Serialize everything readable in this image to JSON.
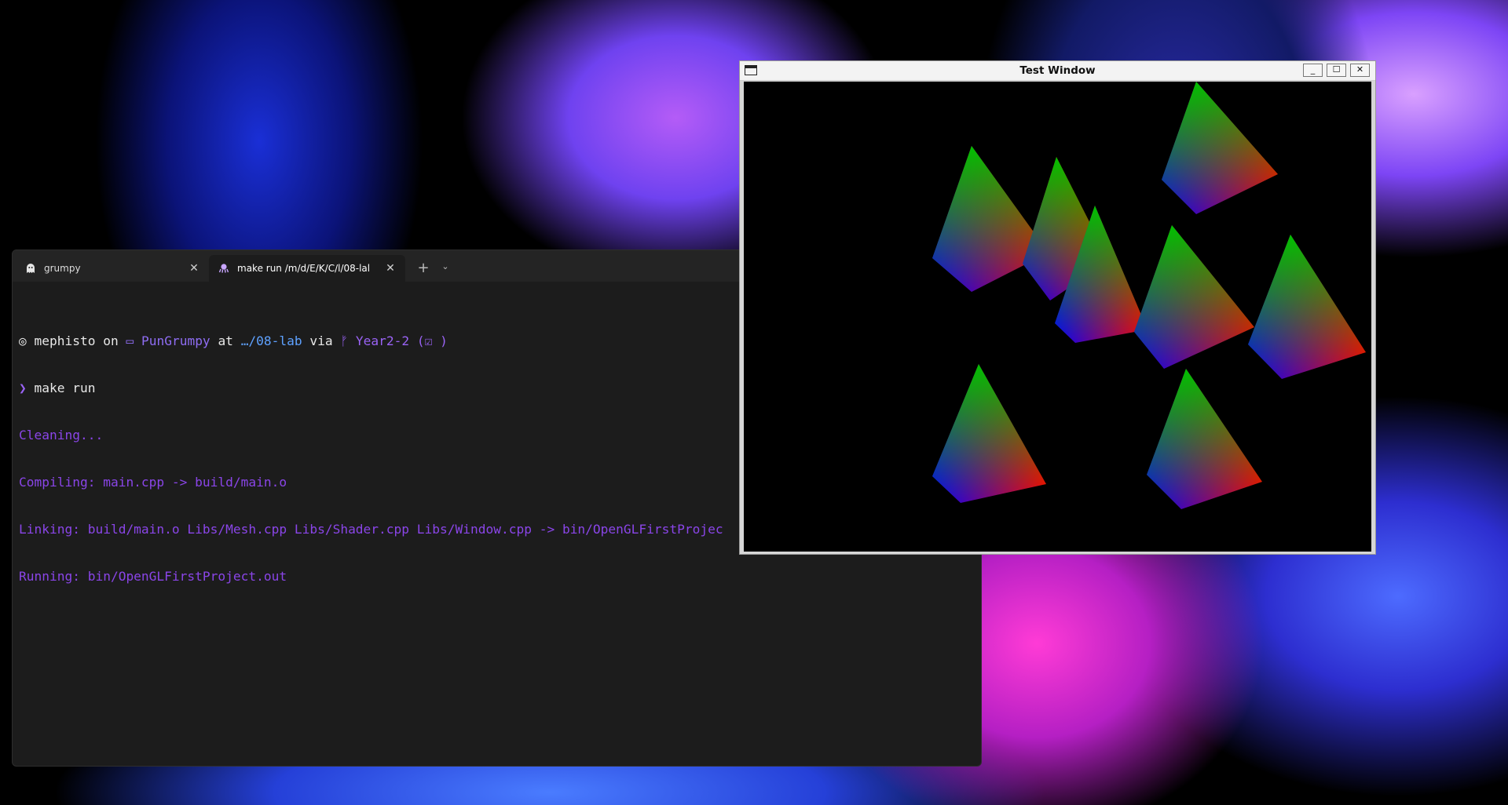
{
  "terminal": {
    "tabs": [
      {
        "label": "grumpy",
        "icon": "ghost-icon"
      },
      {
        "label": "make run /m/d/E/K/C/l/08-lal",
        "icon": "octopus-icon"
      }
    ],
    "new_tab_symbol": "+",
    "dropdown_symbol": "⌄",
    "prompt": {
      "user": "mephisto",
      "on": "on",
      "host_icon": "monitor-icon",
      "host": "PunGrumpy",
      "at": "at",
      "path": "…/08-lab",
      "via": "via",
      "branch_icon": "git-branch-icon",
      "branch": "Year2-2",
      "status": "(☑ )"
    },
    "command_arrow": "❯",
    "command": "make run",
    "output": [
      "Cleaning...",
      "Compiling: main.cpp -> build/main.o",
      "Linking: build/main.o Libs/Mesh.cpp Libs/Shader.cpp Libs/Window.cpp -> bin/OpenGLFirstProjec",
      "Running: bin/OpenGLFirstProject.out"
    ]
  },
  "test_window": {
    "title": "Test Window",
    "minimize": "_",
    "maximize": "☐",
    "close": "✕",
    "pyramid_count": 8,
    "colors": {
      "top": "#00c000",
      "left": "#0000ff",
      "right": "#ff0000",
      "background": "#000000"
    }
  }
}
